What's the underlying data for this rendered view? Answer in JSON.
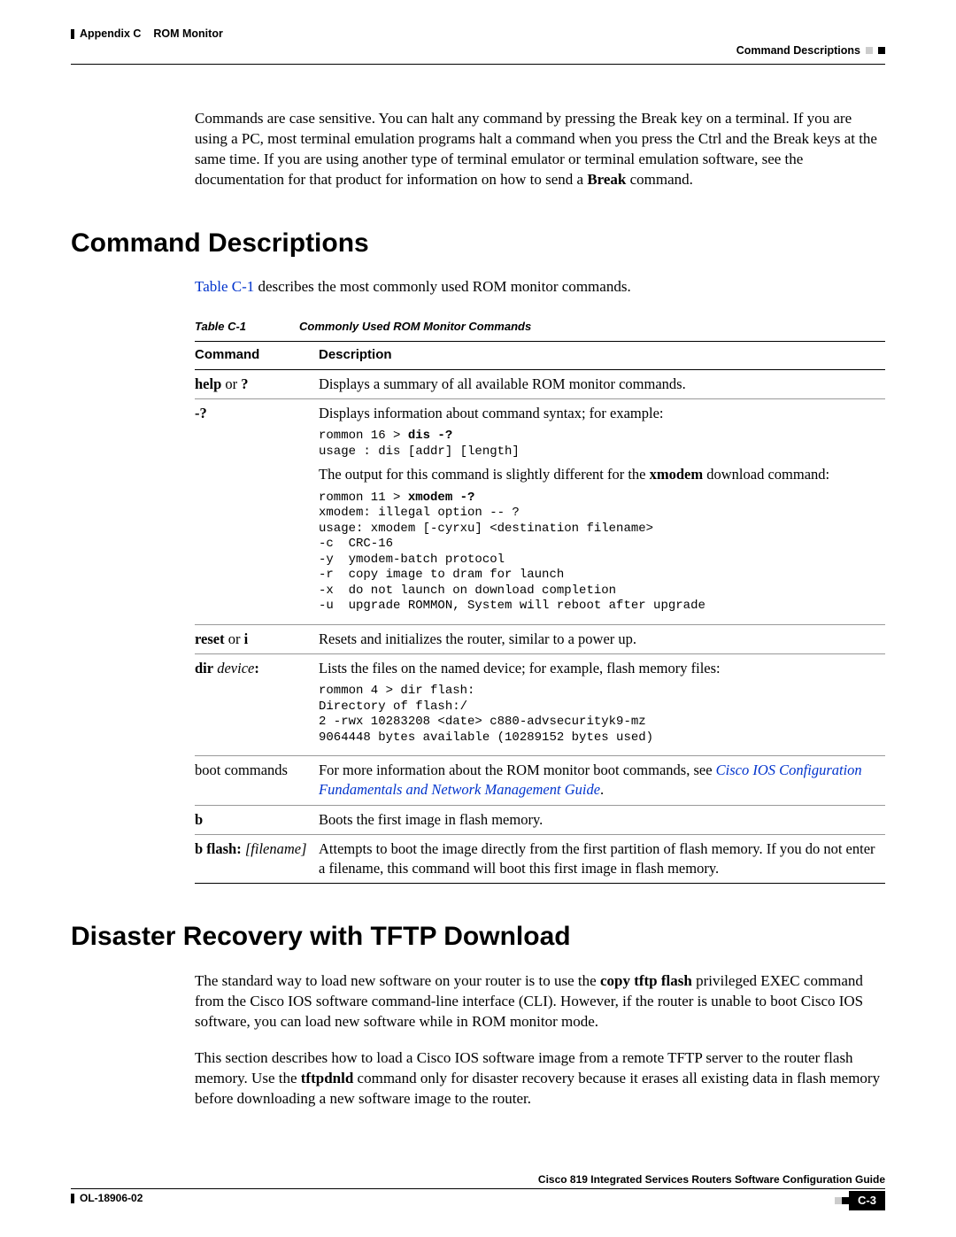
{
  "header": {
    "appendix": "Appendix C",
    "title": "ROM Monitor",
    "section_top": "Command Descriptions"
  },
  "intro_para_parts": {
    "p1": "Commands are case sensitive. You can halt any command by pressing the Break key on a terminal. If you are using a PC, most terminal emulation programs halt a command when you press the Ctrl and the Break keys at the same time. If you are using another type of terminal emulator or terminal emulation software, see the documentation for that product for information on how to send a ",
    "p2_bold": "Break",
    "p3": " command."
  },
  "h1_1": "Command Descriptions",
  "sec1_intro": {
    "link": "Table C-1",
    "rest": " describes the most commonly used ROM monitor commands."
  },
  "table": {
    "caption_num": "Table C-1",
    "caption_title": "Commonly Used ROM Monitor Commands",
    "col1": "Command",
    "col2": "Description",
    "rows": {
      "r1": {
        "cmd_bold": "help",
        "cmd_rest": " or ",
        "cmd_bold2": "?",
        "desc": "Displays a summary of all available ROM monitor commands."
      },
      "r2": {
        "cmd_bold": "-?",
        "desc_intro": "Displays information about command syntax; for example:",
        "code1_a": "rommon 16 > ",
        "code1_b": "dis -?",
        "code1_c": "usage : dis [addr] [length]",
        "desc_mid_a": "The output for this command is slightly different for the ",
        "desc_mid_b": "xmodem",
        "desc_mid_c": " download command:",
        "code2_a": "rommon 11 > ",
        "code2_b": "xmodem -?",
        "code2_rest": "xmodem: illegal option -- ?\nusage: xmodem [-cyrxu] <destination filename>\n-c  CRC-16\n-y  ymodem-batch protocol\n-r  copy image to dram for launch\n-x  do not launch on download completion\n-u  upgrade ROMMON, System will reboot after upgrade"
      },
      "r3": {
        "cmd_bold": "reset",
        "cmd_rest": " or ",
        "cmd_bold2": "i",
        "desc": "Resets and initializes the router, similar to a power up."
      },
      "r4": {
        "cmd_bold": "dir",
        "cmd_italic": " device",
        "cmd_colon": ":",
        "desc_intro": "Lists the files on the named device; for example, flash memory files:",
        "code": "rommon 4 > dir flash:\nDirectory of flash:/\n2 -rwx 10283208 <date> c880-advsecurityk9-mz\n9064448 bytes available (10289152 bytes used)"
      },
      "r5": {
        "cmd": "boot commands",
        "desc_a": "For more information about the ROM monitor boot commands, see ",
        "desc_link": "Cisco IOS Configuration Fundamentals and Network Management Guide",
        "desc_b": "."
      },
      "r6": {
        "cmd_bold": "b",
        "desc": "Boots the first image in flash memory."
      },
      "r7": {
        "cmd_bold": "b flash: ",
        "cmd_italic": "[filename]",
        "desc": "Attempts to boot the image directly from the first partition of flash memory. If you do not enter a filename, this command will boot this first image in flash memory."
      }
    }
  },
  "h1_2": "Disaster Recovery with TFTP Download",
  "sec2": {
    "p1_a": "The standard way to load new software on your router is to use the ",
    "p1_b": "copy tftp flash",
    "p1_c": " privileged EXEC command from the Cisco IOS software command-line interface (CLI). However, if the router is unable to boot Cisco IOS software, you can load new software while in ROM monitor mode.",
    "p2_a": "This section describes how to load a Cisco IOS software image from a remote TFTP server to the router flash memory. Use the ",
    "p2_b": "tftpdnld",
    "p2_c": " command only for disaster recovery because it erases all existing data in flash memory before downloading a new software image to the router."
  },
  "footer": {
    "guide": "Cisco 819 Integrated Services Routers Software Configuration Guide",
    "docnum": "OL-18906-02",
    "page": "C-3"
  }
}
